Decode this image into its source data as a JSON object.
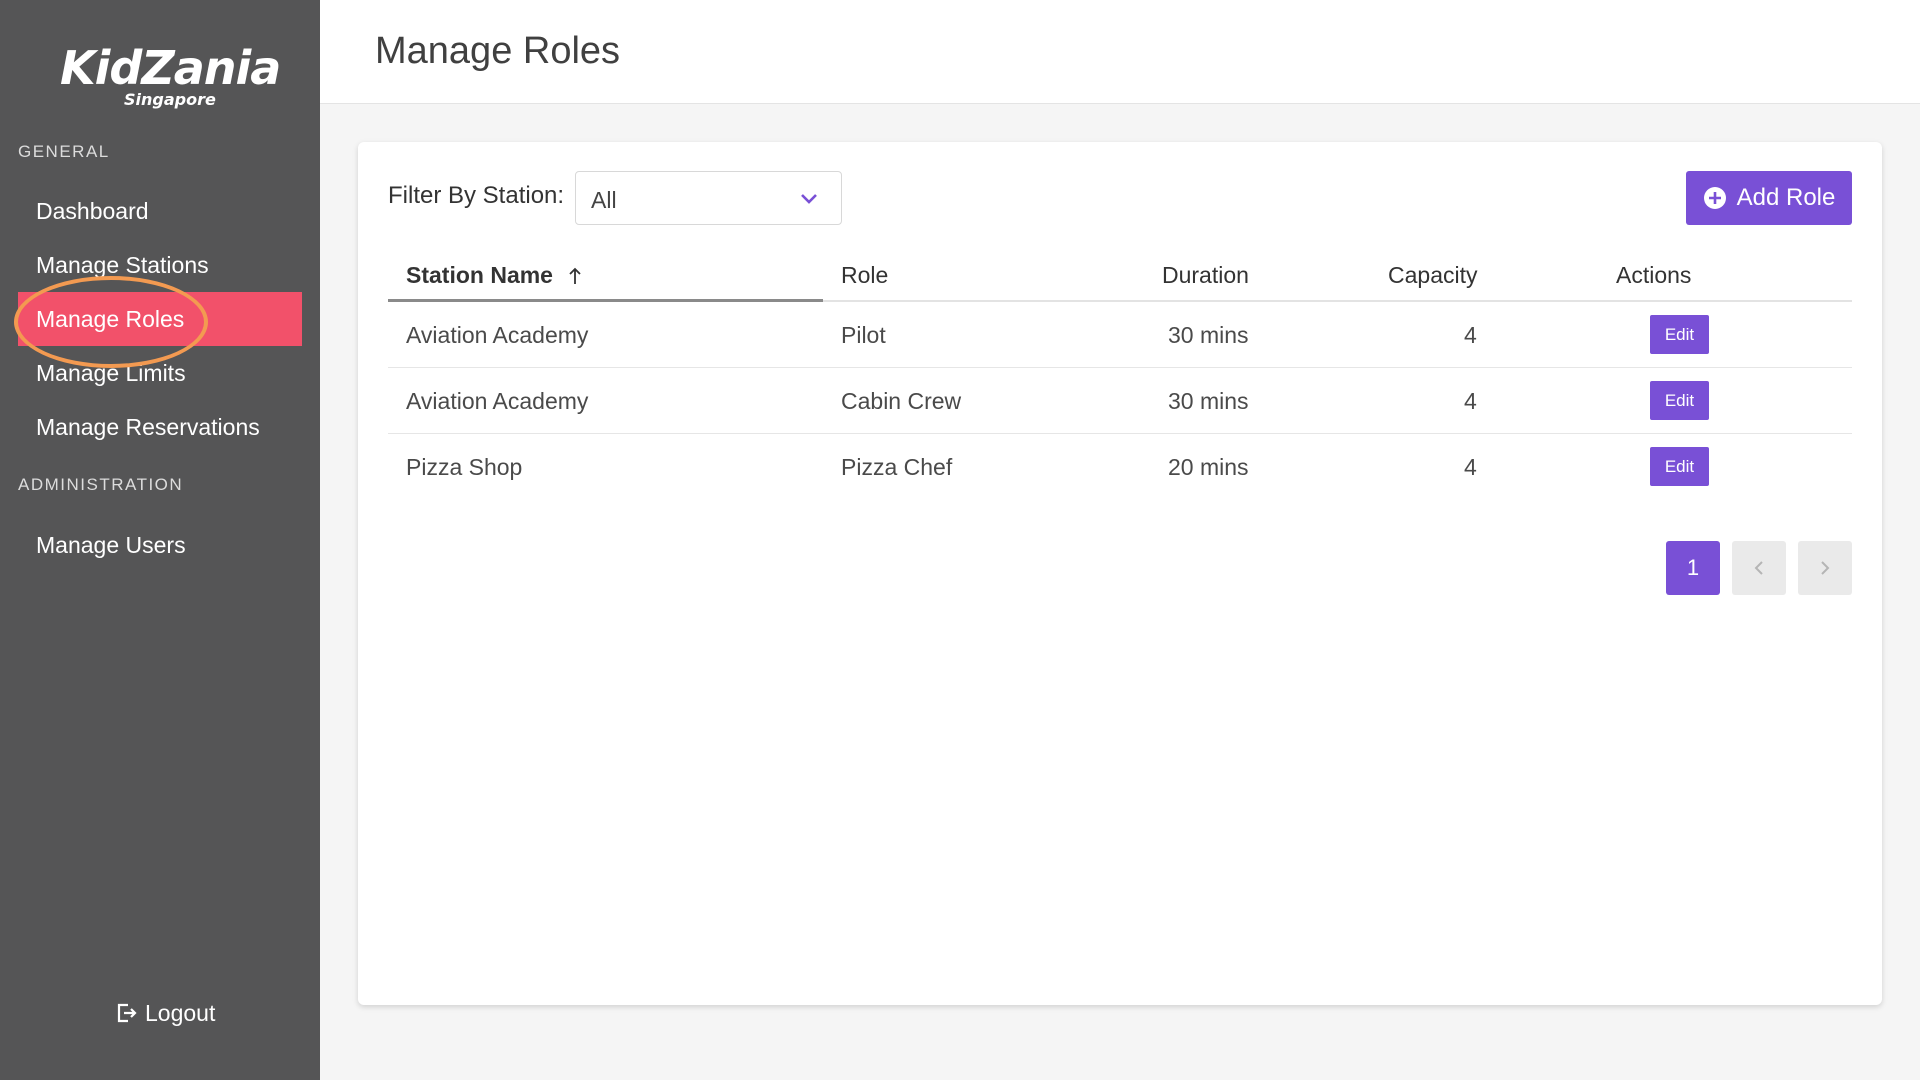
{
  "app": {
    "logo_text": "KidZania",
    "logo_subtext": "Singapore"
  },
  "sidebar": {
    "sections": [
      {
        "label": "GENERAL"
      },
      {
        "label": "ADMINISTRATION"
      }
    ],
    "items": [
      {
        "label": "Dashboard",
        "active": false
      },
      {
        "label": "Manage Stations",
        "active": false
      },
      {
        "label": "Manage Roles",
        "active": true
      },
      {
        "label": "Manage Limits",
        "active": false
      },
      {
        "label": "Manage Reservations",
        "active": false
      },
      {
        "label": "Manage Users",
        "active": false
      }
    ],
    "logout_label": "Logout"
  },
  "header": {
    "title": "Manage Roles"
  },
  "filter": {
    "label": "Filter By Station:",
    "selected": "All"
  },
  "toolbar": {
    "add_label": "Add Role"
  },
  "table": {
    "columns": [
      "Station Name",
      "Role",
      "Duration",
      "Capacity",
      "Actions"
    ],
    "sort": {
      "column": "Station Name",
      "direction": "ascending"
    },
    "rows": [
      {
        "station": "Aviation Academy",
        "role": "Pilot",
        "duration": "30 mins",
        "capacity": "4",
        "action": "Edit"
      },
      {
        "station": "Aviation Academy",
        "role": "Cabin Crew",
        "duration": "30 mins",
        "capacity": "4",
        "action": "Edit"
      },
      {
        "station": "Pizza Shop",
        "role": "Pizza Chef",
        "duration": "20 mins",
        "capacity": "4",
        "action": "Edit"
      }
    ]
  },
  "pagination": {
    "current_page": "1"
  },
  "colors": {
    "sidebar_bg": "#555556",
    "active_item": "#f2516a",
    "accent": "#7950d6",
    "annotation": "#f39a51"
  },
  "icons": {
    "chevron": "chevron-down-icon",
    "add": "plus-circle-icon",
    "sort": "arrow-up-icon",
    "logout": "logout-icon",
    "prev": "chevron-left-icon",
    "next": "chevron-right-icon"
  }
}
